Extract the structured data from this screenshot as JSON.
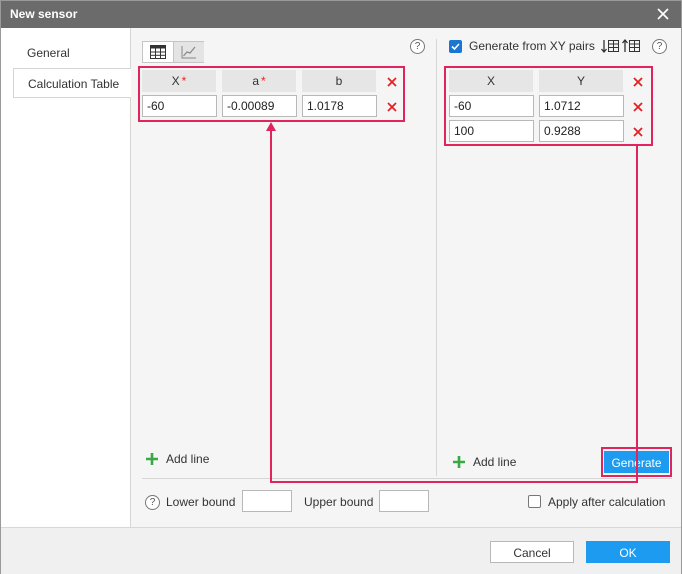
{
  "dialog": {
    "title": "New sensor"
  },
  "sidebar": {
    "items": [
      {
        "label": "General"
      },
      {
        "label": "Calculation Table"
      }
    ]
  },
  "left_table": {
    "headers": {
      "x": "X",
      "a": "a",
      "b": "b"
    },
    "required_mark": "*",
    "rows": [
      {
        "x": "-60",
        "a": "-0.00089",
        "b": "1.0178"
      }
    ],
    "add_line_label": "Add line"
  },
  "right_panel": {
    "generate_checkbox_label": "Generate from XY pairs",
    "generate_checked": true,
    "headers": {
      "x": "X",
      "y": "Y"
    },
    "rows": [
      {
        "x": "-60",
        "y": "1.0712"
      },
      {
        "x": "100",
        "y": "0.9288"
      }
    ],
    "add_line_label": "Add line",
    "generate_button_label": "Generate"
  },
  "bounds": {
    "lower_label": "Lower bound",
    "lower_value": "",
    "upper_label": "Upper bound",
    "upper_value": "",
    "apply_after_label": "Apply after calculation",
    "apply_after_checked": false
  },
  "footer": {
    "cancel_label": "Cancel",
    "ok_label": "OK"
  },
  "colors": {
    "accent": "#1d9bf0",
    "titlebar": "#6b6b6b",
    "highlight": "#e0245e",
    "delete": "#e22222",
    "add": "#3aa845"
  },
  "icons": {
    "close": "close-icon",
    "table_view": "table-icon",
    "chart_view": "chart-line-icon",
    "help": "help-icon",
    "delete": "delete-x-icon",
    "add": "plus-icon",
    "sort_asc": "sort-ascending-icon",
    "sort_desc": "sort-descending-icon"
  }
}
